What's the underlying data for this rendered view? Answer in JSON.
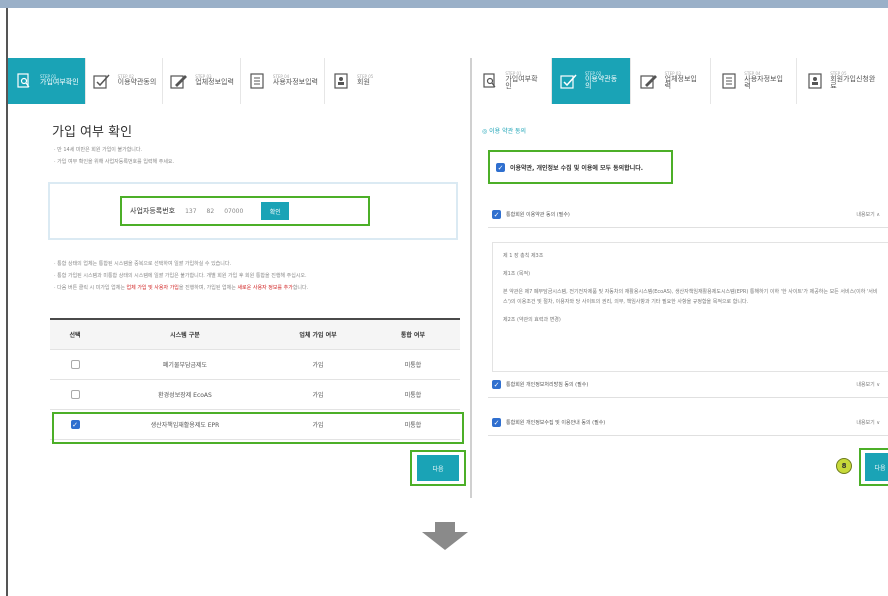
{
  "left": {
    "steps": [
      {
        "no": "STEP 01",
        "label": "가입여부확인",
        "icon": "search-doc-icon",
        "active": true
      },
      {
        "no": "STEP 02",
        "label": "이용약관동의",
        "icon": "checkbox-icon",
        "active": false
      },
      {
        "no": "STEP 03",
        "label": "업체정보입력",
        "icon": "pencil-icon",
        "active": false
      },
      {
        "no": "STEP 04",
        "label": "사용자정보입력",
        "icon": "list-icon",
        "active": false
      },
      {
        "no": "STEP 05",
        "label": "회원",
        "icon": "id-card-icon",
        "active": false
      }
    ],
    "title": "가입 여부 확인",
    "notes1": [
      "· 만 14세 미만은 회원 가입이 불가합니다.",
      "· 가입 여부 확인을 위해 사업자등록번호를 입력해 주세요."
    ],
    "biz": {
      "label": "사업자등록번호",
      "v1": "137",
      "v2": "82",
      "v3": "07000",
      "button": "확인"
    },
    "notes2": {
      "line1": "· 통합 상태의 업체는 통합된 시스템을 중복으로 선택하여 일괄 가입하실 수 있습니다.",
      "line2": "· 통합 가입된 시스템과 미통합 상태의 시스템에 일괄 가입은 불가합니다. 개별 회원 가입 후 회원 통합을 진행해 주십시오.",
      "line3a": "· 다음 버튼 클릭 시 미가입 업체는 ",
      "line3red1": "업체 가입 및 사용자 가입",
      "line3b": "을 진행하며, 가입된 업체는 ",
      "line3red2": "새로운 사용자 정보를 추가",
      "line3c": "합니다."
    },
    "table": {
      "headers": [
        "선택",
        "시스템 구분",
        "업체 가입 여부",
        "통합 여부"
      ],
      "rows": [
        {
          "system": "폐기물부담금제도",
          "joined": "가입",
          "merged": "미통합",
          "checked": false
        },
        {
          "system": "환경성보장제 EcoAS",
          "joined": "가입",
          "merged": "미통합",
          "checked": false
        },
        {
          "system": "생산자책임재활용제도 EPR",
          "joined": "가입",
          "merged": "미통합",
          "checked": true
        }
      ]
    },
    "next": "다음"
  },
  "right": {
    "steps": [
      {
        "no": "STEP 01",
        "label": "가입여부확인",
        "icon": "search-doc-icon",
        "active": false
      },
      {
        "no": "STEP 02",
        "label": "이용약관동의",
        "icon": "checkbox-icon",
        "active": true
      },
      {
        "no": "STEP 03",
        "label": "업체정보입력",
        "icon": "pencil-icon",
        "active": false
      },
      {
        "no": "STEP 04",
        "label": "사용자정보입력",
        "icon": "list-icon",
        "active": false
      },
      {
        "no": "STEP 05",
        "label": "회원가입신청완료",
        "icon": "id-card-icon",
        "active": false
      }
    ],
    "section": "◎ 이용 약관 동의",
    "agree_all": "이용약관, 개인정보 수집 및 이용에 모두 동의합니다.",
    "acc1": "통합회원 이용약관 동의 (필수)",
    "acc1_more": "내용보기 ∧",
    "terms": {
      "ch": "제 1 장 총칙 제3조",
      "art": "제1조 (목적)",
      "body": "본 약관은 제7 폐부담금시스템, 전기전자제품 및 자동차의 재활용시스템(EcoAS), 생산자책임재활용제도시스템(EPR) 통해하기 이하 '한 사이트'가 제공하는 모든 서비스(이하 '서비스')의 이용조건 및 절차, 이용자와 당 사이트의 권리, 의무, 책임사항과 기타 필요한 사항을 규정함을 목적으로 합니다.",
      "art2": "제2조 (약관의 효력과 변경)"
    },
    "acc2": "통합회원 개인정보처리방침 동의 (필수)",
    "acc2_more": "내용보기 ∨",
    "acc3": "통합회원 개인정보수집 및 이용안내 동의 (필수)",
    "acc3_more": "내용보기 ∨",
    "badge": "8",
    "next": "다음"
  }
}
